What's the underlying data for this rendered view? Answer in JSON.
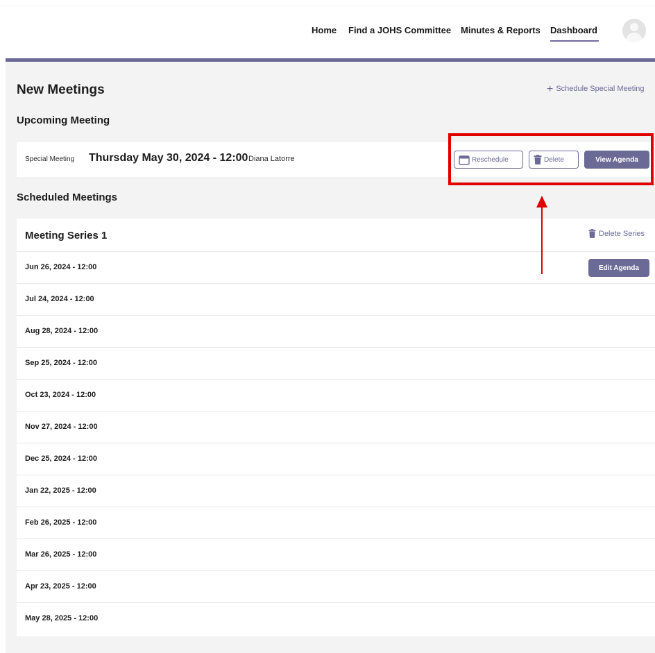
{
  "nav": {
    "items": [
      "Home",
      "Find a JOHS Committee",
      "Minutes & Reports",
      "Dashboard"
    ],
    "active": "Dashboard"
  },
  "page": {
    "title": "New Meetings",
    "schedule_special_label": "Schedule Special Meeting",
    "upcoming_heading": "Upcoming Meeting",
    "scheduled_heading": "Scheduled Meetings"
  },
  "upcoming": {
    "type": "Special Meeting",
    "date": "Thursday May 30, 2024 - 12:00",
    "person": "Diana Latorre",
    "reschedule_label": "Reschedule",
    "delete_label": "Delete",
    "view_agenda_label": "View Agenda"
  },
  "series": {
    "title": "Meeting Series 1",
    "delete_series_label": "Delete Series",
    "edit_agenda_label": "Edit Agenda",
    "dates": [
      "Jun 26, 2024 - 12:00",
      "Jul 24, 2024 - 12:00",
      "Aug 28, 2024 - 12:00",
      "Sep 25, 2024 - 12:00",
      "Oct 23, 2024 - 12:00",
      "Nov 27, 2024 - 12:00",
      "Dec 25, 2024 - 12:00",
      "Jan 22, 2025 - 12:00",
      "Feb 26, 2025 - 12:00",
      "Mar 26, 2025 - 12:00",
      "Apr 23, 2025 - 12:00",
      "May 28, 2025 - 12:00"
    ]
  },
  "colors": {
    "accent": "#6b6a96",
    "annotation": "#e00000",
    "panel": "#f3f3f3"
  },
  "icons": {
    "avatar": "user-avatar-icon",
    "plus": "plus-icon",
    "calendar": "calendar-icon",
    "trash": "trash-icon"
  }
}
